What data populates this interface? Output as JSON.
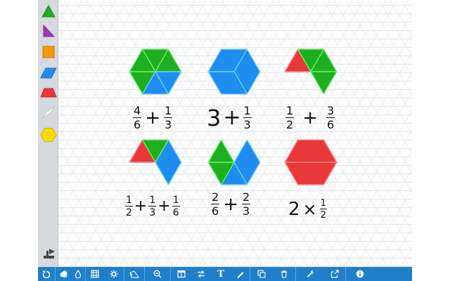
{
  "colors": {
    "green": "#1fae1f",
    "blue": "#1f8cf0",
    "red": "#e8393a",
    "purple": "#9b3ab8",
    "orange": "#f2990e",
    "yellow": "#f9da08",
    "toolbar": "#1f7fcb"
  },
  "palette": {
    "items": [
      "triangle-icon",
      "rhombus-thin-icon",
      "square-icon",
      "rhombus-icon",
      "trapezoid-icon",
      "thin-rhombus-icon",
      "hexagon-icon",
      "stamp-icon"
    ]
  },
  "expressions": [
    {
      "id": "expr-1",
      "parts": [
        {
          "t": "frac",
          "n": "4",
          "d": "6"
        },
        {
          "t": "op",
          "v": "+"
        },
        {
          "t": "frac",
          "n": "1",
          "d": "3"
        }
      ]
    },
    {
      "id": "expr-2",
      "parts": [
        {
          "t": "num",
          "v": "3"
        },
        {
          "t": "op",
          "v": "+"
        },
        {
          "t": "frac",
          "n": "1",
          "d": "3"
        }
      ]
    },
    {
      "id": "expr-3",
      "parts": [
        {
          "t": "frac",
          "n": "1",
          "d": "2"
        },
        {
          "t": "op",
          "v": "+"
        },
        {
          "t": "frac",
          "n": "3",
          "d": "6"
        }
      ]
    },
    {
      "id": "expr-4",
      "parts": [
        {
          "t": "frac",
          "n": "1",
          "d": "2"
        },
        {
          "t": "op",
          "v": "+"
        },
        {
          "t": "frac",
          "n": "1",
          "d": "3"
        },
        {
          "t": "op",
          "v": "+"
        },
        {
          "t": "frac",
          "n": "1",
          "d": "6"
        }
      ]
    },
    {
      "id": "expr-5",
      "parts": [
        {
          "t": "frac",
          "n": "2",
          "d": "6"
        },
        {
          "t": "op",
          "v": "+"
        },
        {
          "t": "frac",
          "n": "2",
          "d": "3"
        }
      ]
    },
    {
      "id": "expr-6",
      "parts": [
        {
          "t": "num",
          "v": "2"
        },
        {
          "t": "op",
          "v": "×"
        },
        {
          "t": "frac",
          "n": "1",
          "d": "2"
        }
      ]
    }
  ],
  "toolbar": {
    "items": [
      "refresh-icon",
      "layers-icon",
      "fill-drop-icon",
      "grid-icon",
      "settings-icon",
      "shape-outline-icon",
      "zoom-out-icon",
      "window-icon",
      "swap-icon",
      "text-tool-icon",
      "pen-icon",
      "duplicate-icon",
      "trash-icon",
      "wrench-icon",
      "share-icon",
      "info-icon"
    ],
    "text_tool_label": "T"
  }
}
